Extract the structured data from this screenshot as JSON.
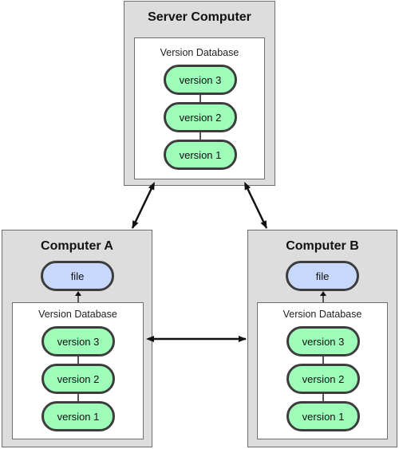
{
  "diagram": {
    "server": {
      "title": "Server Computer",
      "database": {
        "title": "Version Database",
        "versions": [
          "version 3",
          "version 2",
          "version 1"
        ]
      }
    },
    "computer_a": {
      "title": "Computer A",
      "file_label": "file",
      "database": {
        "title": "Version Database",
        "versions": [
          "version 3",
          "version 2",
          "version 1"
        ]
      }
    },
    "computer_b": {
      "title": "Computer B",
      "file_label": "file",
      "database": {
        "title": "Version Database",
        "versions": [
          "version 3",
          "version 2",
          "version 1"
        ]
      }
    },
    "connections": [
      {
        "from": "Server Computer",
        "to": "Computer A",
        "type": "bidirectional"
      },
      {
        "from": "Server Computer",
        "to": "Computer B",
        "type": "bidirectional"
      },
      {
        "from": "Computer A",
        "to": "Computer B",
        "type": "bidirectional"
      }
    ],
    "colors": {
      "version_fill": "#9dfdb9",
      "file_fill": "#c7d8fc",
      "outer_box_fill": "#dddddd",
      "inner_box_fill": "#ffffff",
      "stroke": "#3d3d3d"
    }
  }
}
